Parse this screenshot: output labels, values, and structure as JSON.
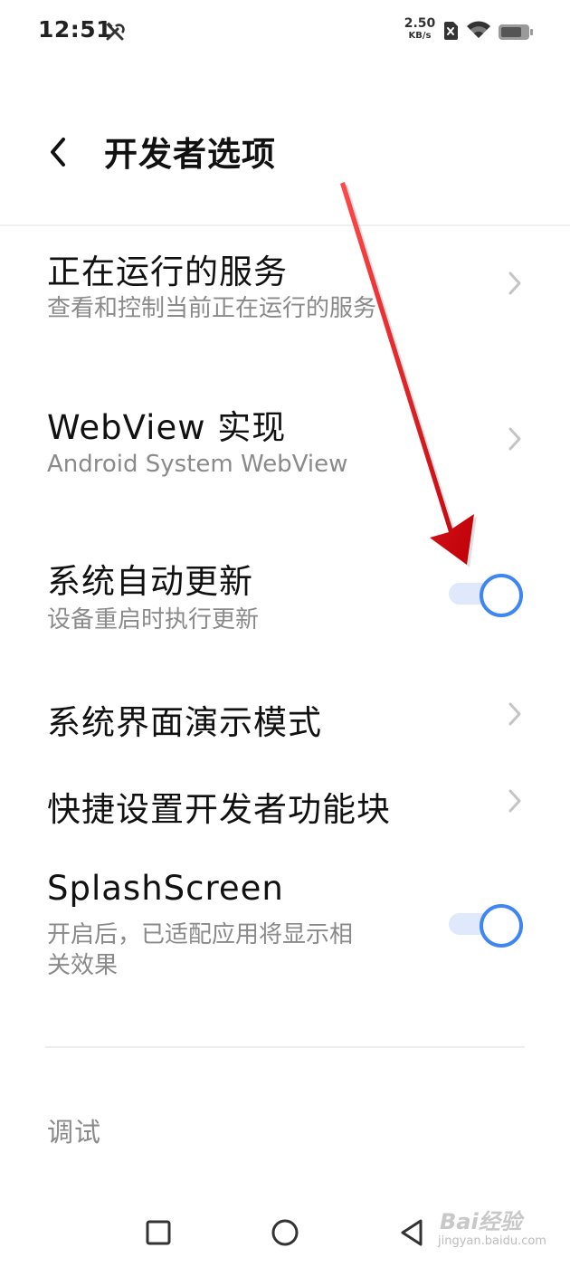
{
  "status_bar": {
    "time": "12:51",
    "net_speed_value": "2.50",
    "net_speed_unit": "KB/s",
    "icons": [
      "tools-icon",
      "sim-disabled-icon",
      "wifi-icon",
      "battery-icon"
    ]
  },
  "header": {
    "title": "开发者选项",
    "back_icon": "chevron-left-icon"
  },
  "rows": [
    {
      "title": "正在运行的服务",
      "subtitle": "查看和控制当前正在运行的服务",
      "control": "chevron"
    },
    {
      "title": "WebView 实现",
      "subtitle": "Android System WebView",
      "control": "chevron"
    },
    {
      "title": "系统自动更新",
      "subtitle": "设备重启时执行更新",
      "control": "toggle",
      "checked": true
    },
    {
      "title": "系统界面演示模式",
      "control": "chevron"
    },
    {
      "title": "快捷设置开发者功能块",
      "control": "chevron"
    },
    {
      "title": "SplashScreen",
      "subtitle_line1": "开启后，已适配应用将显示相",
      "subtitle_line2": "关效果",
      "control": "toggle",
      "checked": true
    }
  ],
  "section": {
    "title": "调试"
  },
  "nav_bar": {
    "icons": [
      "recent-apps-icon",
      "home-icon",
      "back-triangle-icon"
    ]
  },
  "watermark": {
    "brand": "Bai经验",
    "url": "jingyan.baidu.com"
  },
  "colors": {
    "accent": "#3f86f2",
    "toggle_track": "#dfe9fb",
    "arrow": "#e8141b",
    "subtitle": "#8a8a8a"
  }
}
